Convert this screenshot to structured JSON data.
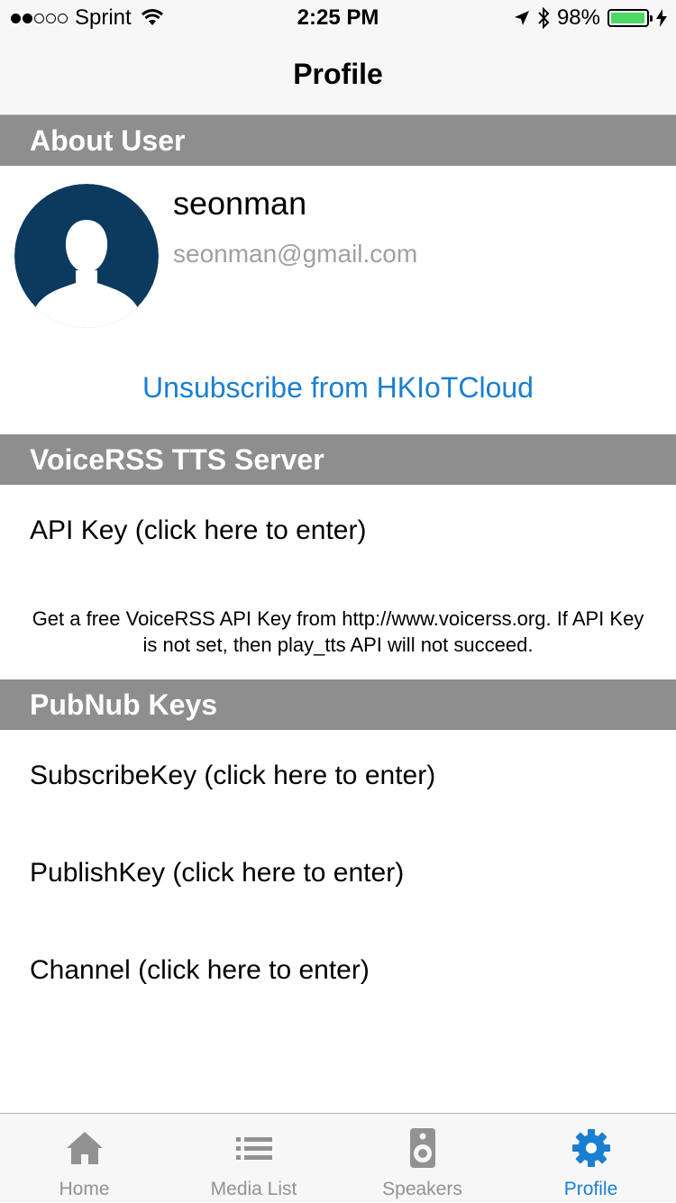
{
  "status_bar": {
    "carrier": "Sprint",
    "time": "2:25 PM",
    "battery": "98%",
    "battery_level": 0.98
  },
  "nav": {
    "title": "Profile"
  },
  "about": {
    "header": "About User",
    "username": "seonman",
    "email": "seonman@gmail.com",
    "unsubscribe": "Unsubscribe from HKIoTCloud"
  },
  "voicerss": {
    "header": "VoiceRSS TTS Server",
    "api_key": "API Key (click here to enter)",
    "note": "Get a free VoiceRSS API Key from http://www.voicerss.org. If API Key is not set, then play_tts API will not succeed."
  },
  "pubnub": {
    "header": "PubNub Keys",
    "subscribe_key": "SubscribeKey (click here to enter)",
    "publish_key": "PublishKey (click here to enter)",
    "channel": "Channel (click here to enter)"
  },
  "tabs": [
    {
      "label": "Home",
      "icon": "home-icon",
      "active": false
    },
    {
      "label": "Media List",
      "icon": "list-icon",
      "active": false
    },
    {
      "label": "Speakers",
      "icon": "speaker-icon",
      "active": false
    },
    {
      "label": "Profile",
      "icon": "gear-icon",
      "active": true
    }
  ],
  "colors": {
    "accent": "#1a7fd1",
    "section_header": "#8e8e8e",
    "avatar_bg": "#0b3a5e"
  }
}
